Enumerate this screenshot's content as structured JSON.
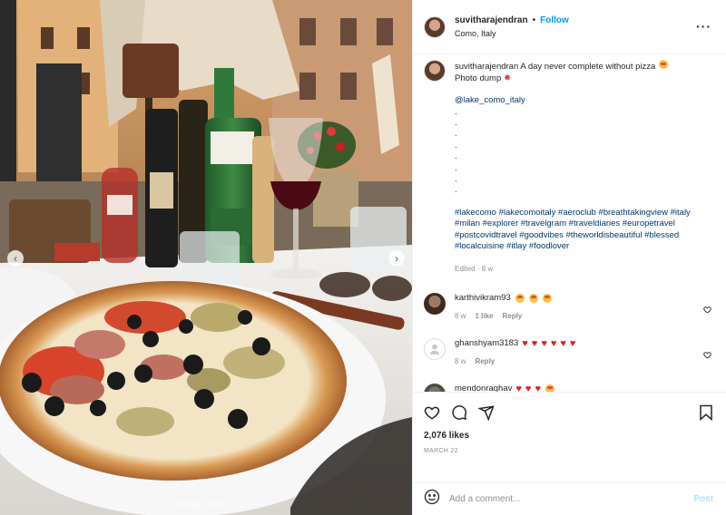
{
  "header": {
    "username": "suvitharajendran",
    "follow_label": "Follow",
    "separator": "•",
    "location": "Como, Italy",
    "more_icon": "more-horizontal-icon",
    "more_label": "···"
  },
  "carousel": {
    "left_arrow": "‹",
    "right_arrow": "›",
    "slide_count": 10,
    "active_index": 3
  },
  "caption": {
    "username": "suvitharajendran",
    "text_line1": "A day never complete without pizza",
    "text_line2": "Photo dump",
    "mention": "@lake_como_italy",
    "dots": [
      ".",
      ".",
      ".",
      ".",
      ".",
      ".",
      ".",
      "."
    ],
    "hashtags": "#lakecomo #lakecomoitaly #aeroclub #breathtakingview #italy #milan #explorer #travelgram #traveldiaries #europetravel #postcovidtravel #goodvibes #theworldisbeautiful #blessed #localcuisine #itlay #foodlover",
    "edited_label": "Edited",
    "time": "8 w"
  },
  "comments": [
    {
      "username": "karthivikram93",
      "emojis": [
        "face",
        "face",
        "face"
      ],
      "time": "8 w",
      "likes": "1 like",
      "reply": "Reply"
    },
    {
      "username": "ghanshyam3183",
      "emojis": [
        "heart",
        "heart",
        "heart",
        "heart",
        "heart",
        "heart"
      ],
      "time": "8 w",
      "reply": "Reply"
    },
    {
      "username": "mendonraghav",
      "emojis": [
        "heart",
        "heart",
        "heart",
        "face"
      ],
      "time": "8 w",
      "reply": "Reply"
    }
  ],
  "actions": {
    "likes": "2,076 likes",
    "date": "MARCH 22"
  },
  "add_comment": {
    "placeholder": "Add a comment...",
    "post_label": "Post"
  },
  "colors": {
    "accent": "#0095f6",
    "hashtag": "#00376b",
    "heart": "#e02020",
    "muted": "#8e8e8e"
  }
}
